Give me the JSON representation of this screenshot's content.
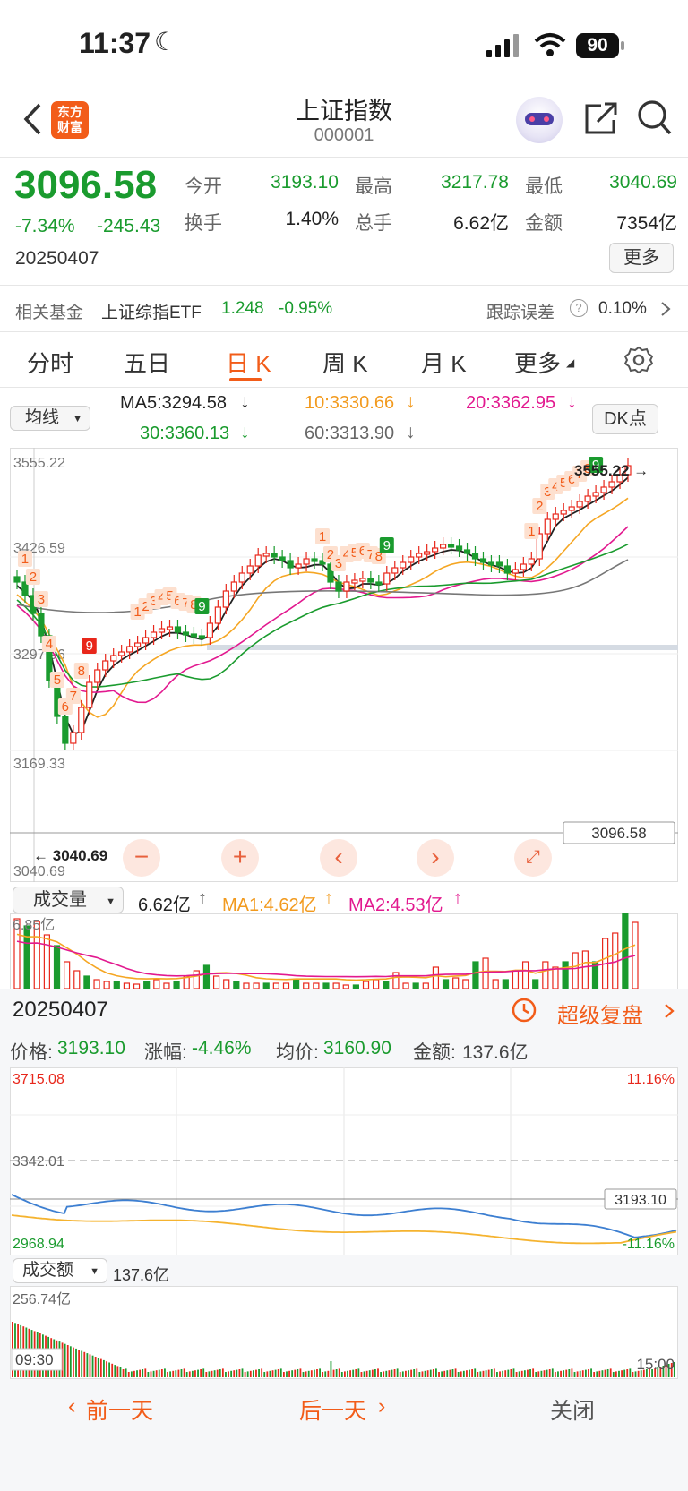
{
  "status_bar": {
    "time": "11:37",
    "battery": "90"
  },
  "nav": {
    "title": "上证指数",
    "code": "000001",
    "logo_line1": "东方",
    "logo_line2": "财富"
  },
  "quote": {
    "price": "3096.58",
    "change_pct": "-7.34%",
    "change_amt": "-245.43",
    "date": "20250407",
    "open_label": "今开",
    "open": "3193.10",
    "high_label": "最高",
    "high": "3217.78",
    "low_label": "最低",
    "low": "3040.69",
    "turnover_label": "换手",
    "turnover": "1.40%",
    "volume_label": "总手",
    "volume": "6.62亿",
    "amount_label": "金额",
    "amount": "7354亿",
    "more_button": "更多"
  },
  "fund": {
    "label": "相关基金",
    "name": "上证综指ETF",
    "price": "1.248",
    "change": "-0.95%",
    "tracking_label": "跟踪误差",
    "tracking_value": "0.10%"
  },
  "tabs": [
    "分时",
    "五日",
    "日 K",
    "周 K",
    "月 K",
    "更多"
  ],
  "active_tab": "日 K",
  "ma": {
    "selector": "均线",
    "ma5": "MA5:3294.58",
    "ma10": "10:3330.66",
    "ma20": "20:3362.95",
    "ma30": "30:3360.13",
    "ma60": "60:3313.90",
    "dk_button": "DK点"
  },
  "kline": {
    "y_max": "3555.22",
    "y_2": "3426.59",
    "y_3": "3297.96",
    "y_4": "3169.33",
    "y_min": "3040.69",
    "high_mark": "3555.22",
    "low_mark": "3040.69",
    "current_price_tag": "3096.58"
  },
  "volume_panel": {
    "selector": "成交量",
    "value": "6.62亿",
    "ma1": "MA1:4.62亿",
    "ma2": "MA2:4.53亿",
    "max": "6.85亿"
  },
  "intraday": {
    "date": "20250407",
    "replay_label": "超级复盘",
    "price_label": "价格:",
    "price": "3193.10",
    "chg_label": "涨幅:",
    "chg": "-4.46%",
    "avg_label": "均价:",
    "avg": "3160.90",
    "amt_label": "金额:",
    "amt": "137.6亿",
    "y_max": "3715.08",
    "y_mid": "3342.01",
    "y_min": "2968.94",
    "pct_max": "11.16%",
    "pct_min": "-11.16%",
    "price_tag": "3193.10",
    "amount_selector": "成交额",
    "amount_value": "137.6亿",
    "amount_max": "256.74亿",
    "time_start": "09:30",
    "time_end": "15:00"
  },
  "bottom": {
    "prev": "前一天",
    "next": "后一天",
    "close": "关闭"
  },
  "colors": {
    "up": "#e8271b",
    "down": "#1a9b2e",
    "accent": "#f25c19",
    "ma5": "#222222",
    "ma10": "#f5a623",
    "ma20": "#e2198f",
    "ma30": "#1a9b2e",
    "ma60": "#777777"
  }
}
